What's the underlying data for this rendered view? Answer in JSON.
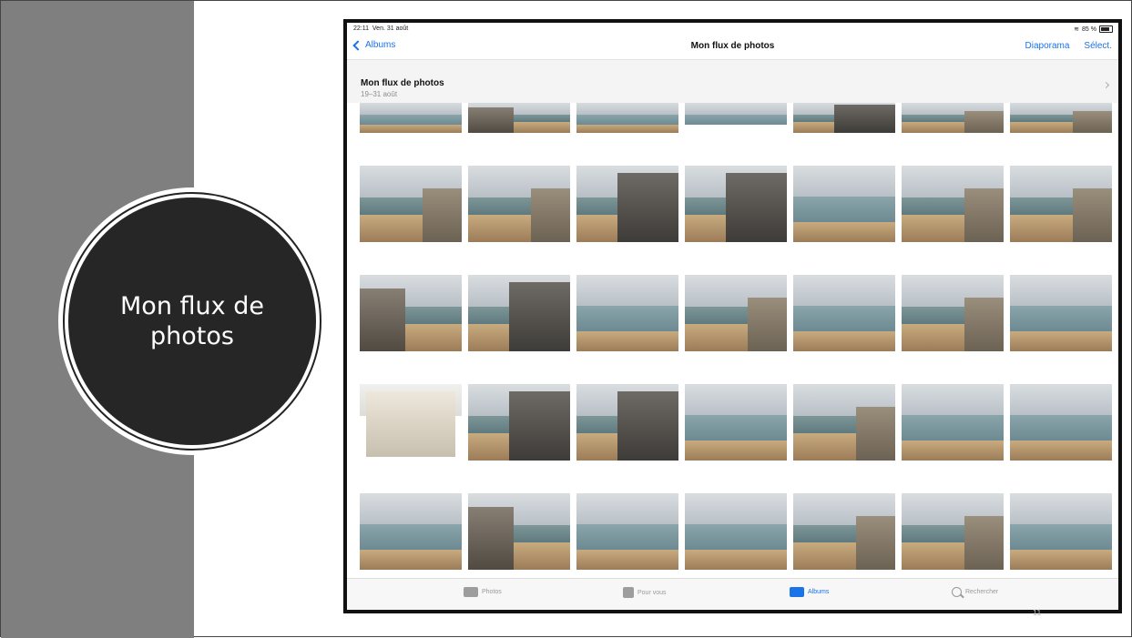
{
  "slide": {
    "title": "Mon flux de photos"
  },
  "ipad": {
    "status": {
      "time": "22:11",
      "date": "Ven. 31 août",
      "battery": "85 %"
    },
    "nav": {
      "back_label": "Albums",
      "title": "Mon flux de photos",
      "slideshow": "Diaporama",
      "select": "Sélect."
    },
    "section": {
      "title": "Mon flux de photos",
      "subtitle": "19–31 août"
    },
    "tabs": [
      {
        "label": "Photos",
        "icon": "photos-icon",
        "active": false
      },
      {
        "label": "Pour vous",
        "icon": "for-you-icon",
        "active": false
      },
      {
        "label": "Albums",
        "icon": "albums-icon",
        "active": true
      },
      {
        "label": "Rechercher",
        "icon": "search-icon",
        "active": false
      }
    ]
  },
  "page_number": "11",
  "colors": {
    "accent": "#1a73e8",
    "left_bar": "#7f7f7f",
    "circle": "#262626"
  }
}
